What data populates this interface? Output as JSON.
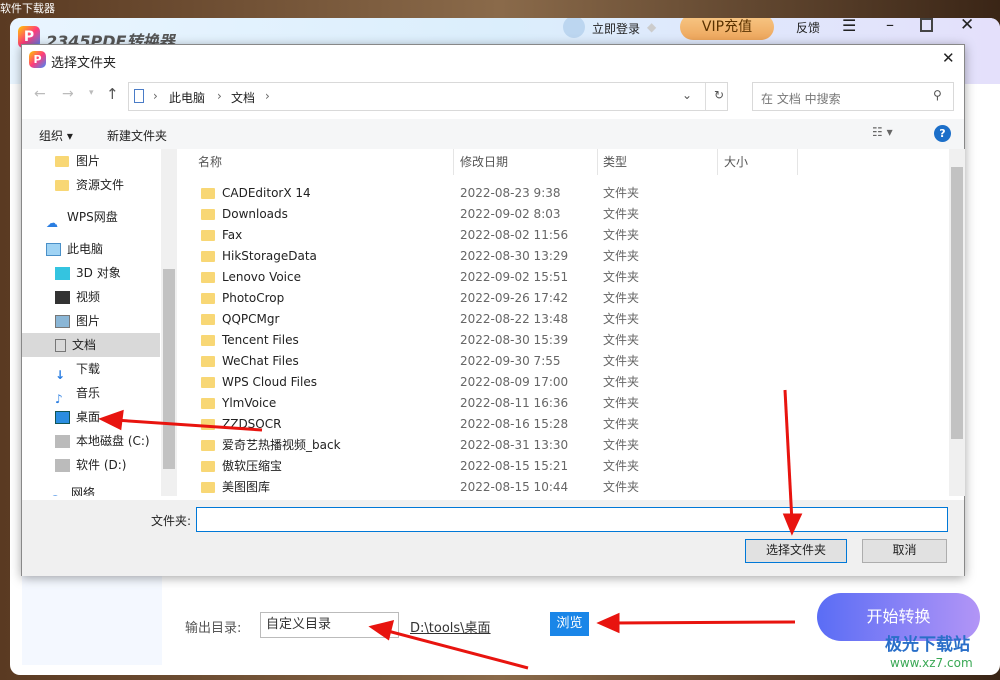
{
  "background_caption": "软件下载器",
  "app": {
    "name": "2345PDF转换器",
    "login": "立即登录",
    "vip": "VIP充值",
    "feedback": "反馈",
    "output_label": "输出目录:",
    "output_select": "自定义目录",
    "output_path": "D:\\tools\\桌面",
    "browse": "浏览",
    "start": "开始转换"
  },
  "dialog": {
    "title": "选择文件夹",
    "breadcrumb": [
      "此电脑",
      "文档"
    ],
    "search_placeholder": "在 文档 中搜索",
    "organize": "组织",
    "new_folder": "新建文件夹",
    "nav": [
      "图片",
      "资源文件",
      "WPS网盘",
      "此电脑",
      "3D 对象",
      "视频",
      "图片",
      "文档",
      "下载",
      "音乐",
      "桌面",
      "本地磁盘 (C:)",
      "软件 (D:)",
      "网络"
    ],
    "columns": [
      "名称",
      "修改日期",
      "类型",
      "大小"
    ],
    "files": [
      {
        "name": "CADEditorX 14",
        "date": "2022-08-23 9:38",
        "type": "文件夹"
      },
      {
        "name": "Downloads",
        "date": "2022-09-02 8:03",
        "type": "文件夹"
      },
      {
        "name": "Fax",
        "date": "2022-08-02 11:56",
        "type": "文件夹"
      },
      {
        "name": "HikStorageData",
        "date": "2022-08-30 13:29",
        "type": "文件夹"
      },
      {
        "name": "Lenovo Voice",
        "date": "2022-09-02 15:51",
        "type": "文件夹"
      },
      {
        "name": "PhotoCrop",
        "date": "2022-09-26 17:42",
        "type": "文件夹"
      },
      {
        "name": "QQPCMgr",
        "date": "2022-08-22 13:48",
        "type": "文件夹"
      },
      {
        "name": "Tencent Files",
        "date": "2022-08-30 15:39",
        "type": "文件夹"
      },
      {
        "name": "WeChat Files",
        "date": "2022-09-30 7:55",
        "type": "文件夹"
      },
      {
        "name": "WPS Cloud Files",
        "date": "2022-08-09 17:00",
        "type": "文件夹"
      },
      {
        "name": "YlmVoice",
        "date": "2022-08-11 16:36",
        "type": "文件夹"
      },
      {
        "name": "ZZDSOCR",
        "date": "2022-08-16 15:28",
        "type": "文件夹"
      },
      {
        "name": "爱奇艺热播视频_back",
        "date": "2022-08-31 13:30",
        "type": "文件夹"
      },
      {
        "name": "傲软压缩宝",
        "date": "2022-08-15 15:21",
        "type": "文件夹"
      },
      {
        "name": "美图图库",
        "date": "2022-08-15 10:44",
        "type": "文件夹"
      }
    ],
    "folder_label": "文件夹:",
    "folder_value": "",
    "select_button": "选择文件夹",
    "cancel_button": "取消"
  },
  "watermark": {
    "text": "极光下载站",
    "url": "www.xz7.com"
  }
}
